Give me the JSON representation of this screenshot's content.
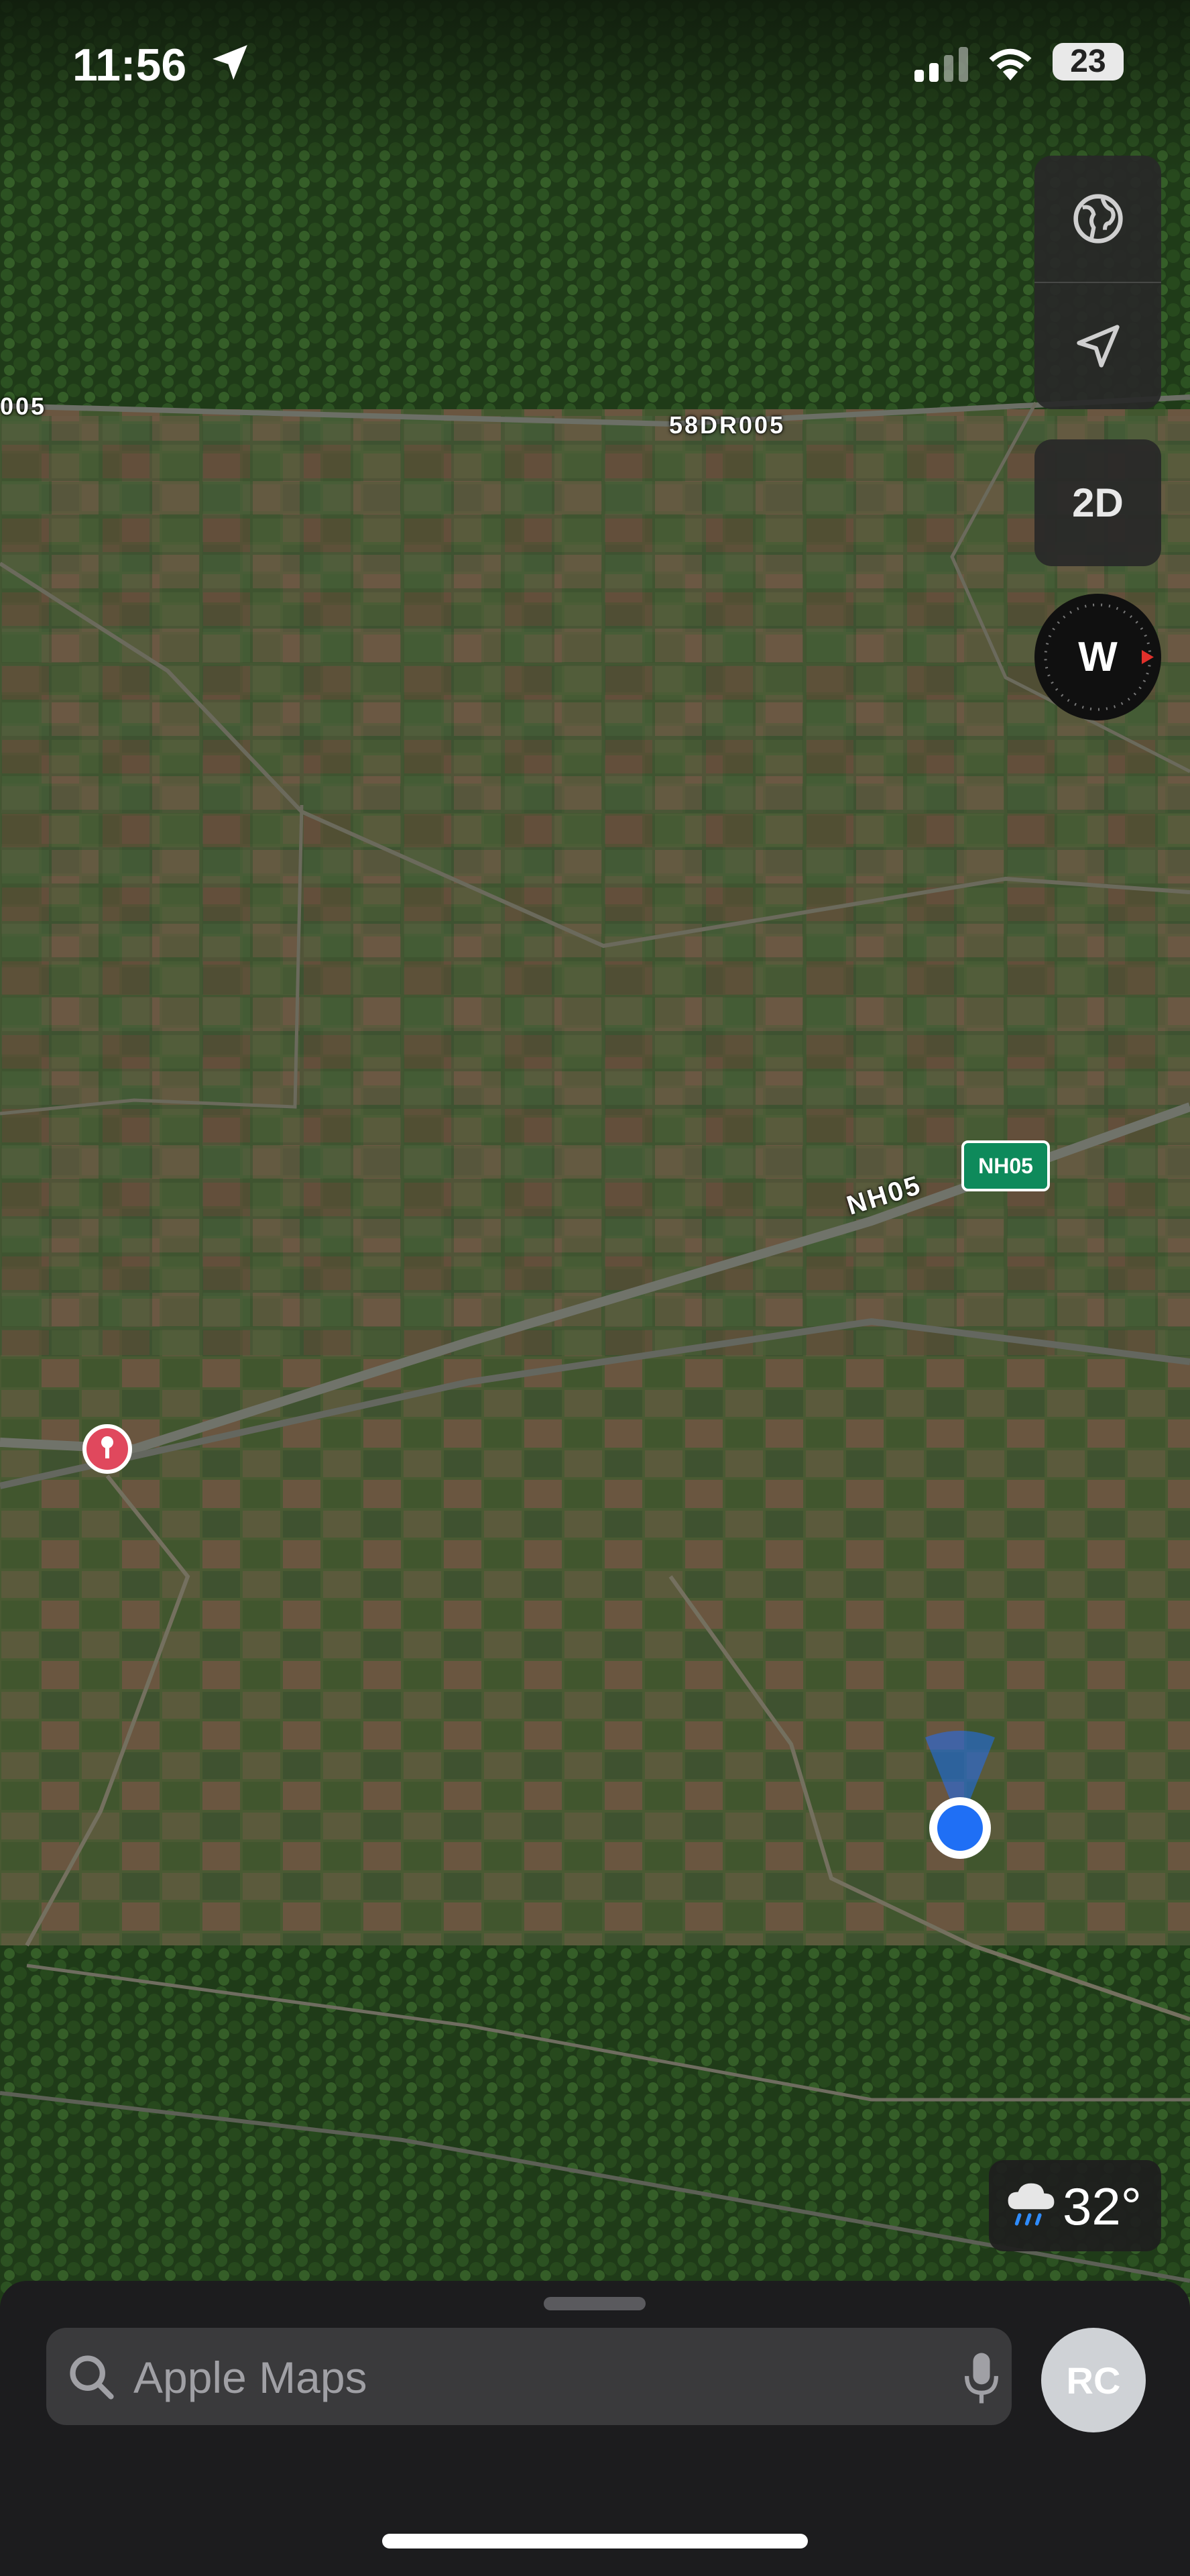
{
  "status_bar": {
    "time": "11:56",
    "battery": "23",
    "location_icon": "location-arrow-icon",
    "signal_icon": "cellular-signal-icon",
    "wifi_icon": "wifi-icon"
  },
  "map": {
    "view": "satellite-3d",
    "road_labels": [
      "58DR005",
      "005",
      "NH05"
    ],
    "route_shield": "NH05",
    "route_shield_color": "#0e8a5b",
    "pin_color": "#e0485d",
    "user_location_color": "#1f6ff5"
  },
  "controls": {
    "globe_icon": "globe-icon",
    "locate_icon": "location-arrow-icon",
    "view_mode": "2D",
    "compass_heading": "W",
    "compass_icon": "compass-icon"
  },
  "weather": {
    "temperature": "32°",
    "icon": "rain-cloud-icon"
  },
  "search": {
    "placeholder": "Apple Maps",
    "search_icon": "search-icon",
    "mic_icon": "microphone-icon"
  },
  "user": {
    "initials": "RC"
  }
}
